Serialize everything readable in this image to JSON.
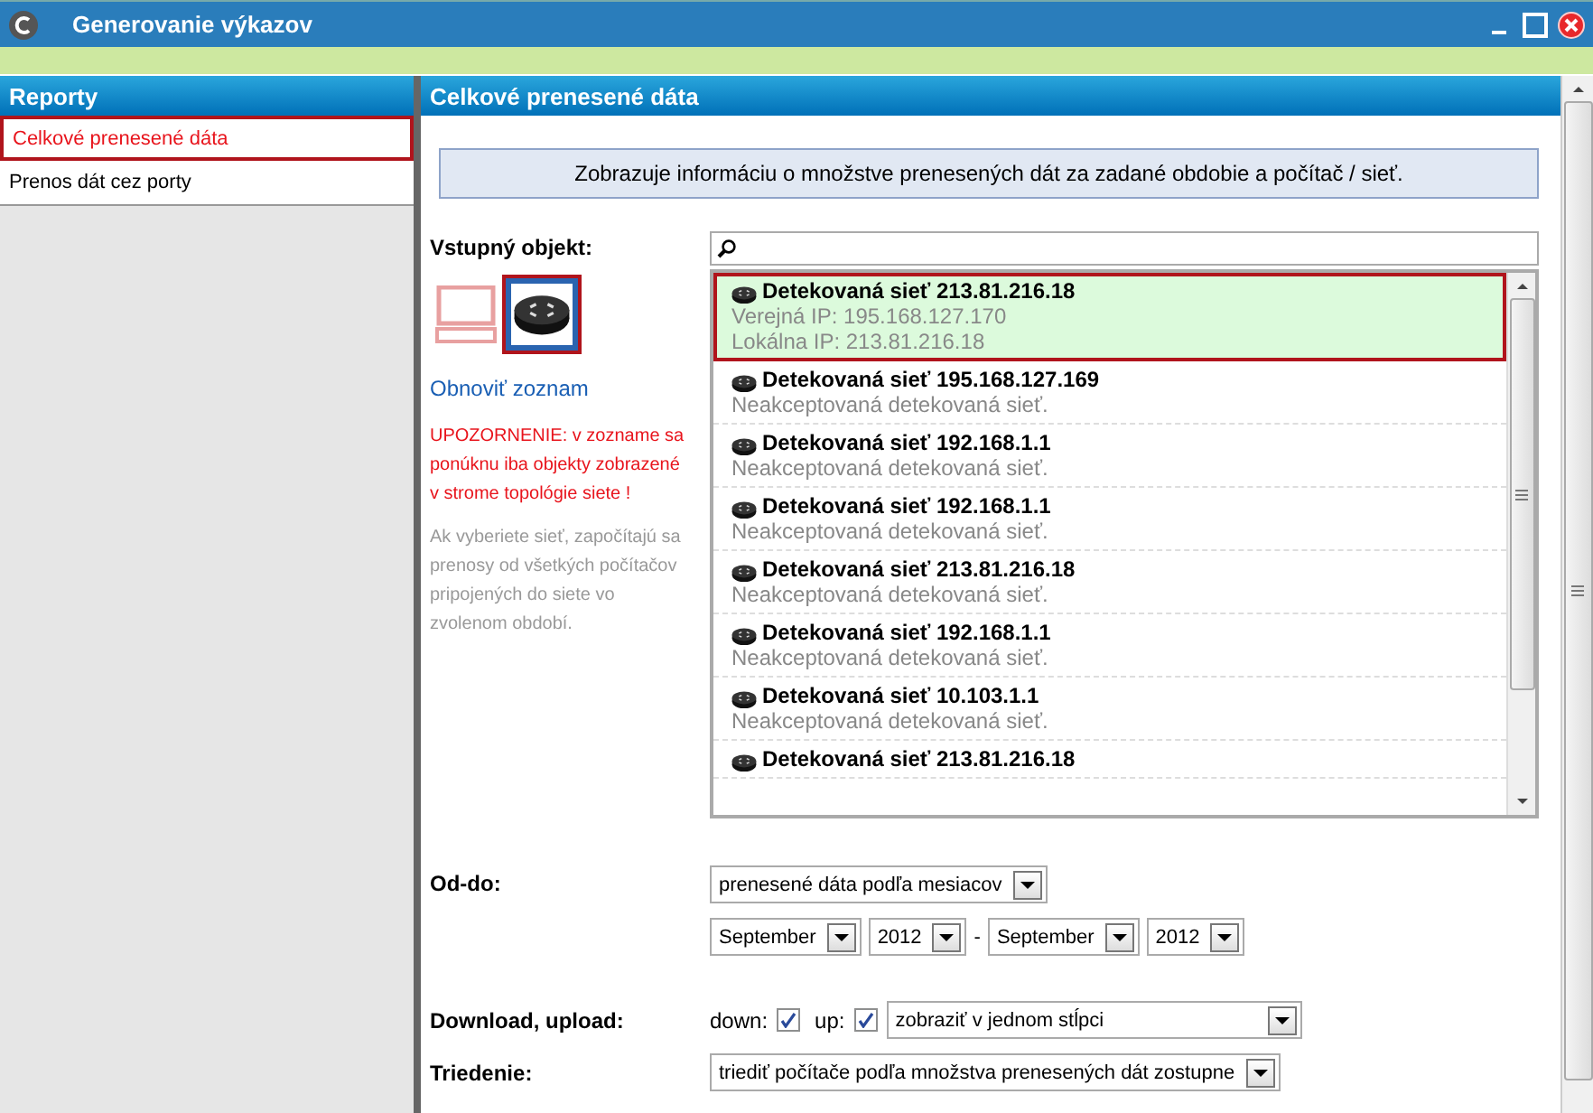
{
  "window": {
    "title": "Generovanie výkazov"
  },
  "sidebar": {
    "title": "Reporty",
    "items": [
      {
        "label": "Celkové prenesené dáta",
        "selected": true
      },
      {
        "label": "Prenos dát cez porty",
        "selected": false
      }
    ]
  },
  "main": {
    "title": "Celkové prenesené dáta",
    "description": "Zobrazuje informáciu o množstve prenesených dát za zadané obdobie a počítač / sieť.",
    "input_object": {
      "label": "Vstupný objekt:",
      "object_types": [
        {
          "kind": "computer",
          "selected": false
        },
        {
          "kind": "network",
          "selected": true
        }
      ],
      "refresh_link": "Obnoviť zoznam",
      "warning": "UPOZORNENIE: v zozname sa ponúknu iba objekty zobrazené v strome topológie siete !",
      "hint": "Ak vyberiete sieť, započítajú sa prenosy od všetkých počítačov pripojených do siete vo zvolenom období.",
      "items": [
        {
          "title": "Detekovaná sieť 213.81.216.18",
          "lines": [
            "Verejná IP: 195.168.127.170",
            "Lokálna IP: 213.81.216.18"
          ],
          "selected": true
        },
        {
          "title": "Detekovaná sieť 195.168.127.169",
          "lines": [
            "Neakceptovaná detekovaná sieť."
          ],
          "selected": false
        },
        {
          "title": "Detekovaná sieť 192.168.1.1",
          "lines": [
            "Neakceptovaná detekovaná sieť."
          ],
          "selected": false
        },
        {
          "title": "Detekovaná sieť 192.168.1.1",
          "lines": [
            "Neakceptovaná detekovaná sieť."
          ],
          "selected": false
        },
        {
          "title": "Detekovaná sieť 213.81.216.18",
          "lines": [
            "Neakceptovaná detekovaná sieť."
          ],
          "selected": false
        },
        {
          "title": "Detekovaná sieť 192.168.1.1",
          "lines": [
            "Neakceptovaná detekovaná sieť."
          ],
          "selected": false
        },
        {
          "title": "Detekovaná sieť 10.103.1.1",
          "lines": [
            "Neakceptovaná detekovaná sieť."
          ],
          "selected": false
        },
        {
          "title": "Detekovaná sieť 213.81.216.18",
          "selected": false
        }
      ]
    },
    "period": {
      "label": "Od-do:",
      "mode": "prenesené dáta podľa mesiacov",
      "from_month": "September",
      "from_year": "2012",
      "separator": "-",
      "to_month": "September",
      "to_year": "2012"
    },
    "traffic": {
      "label": "Download, upload:",
      "down_label": "down:",
      "down_checked": true,
      "up_label": "up:",
      "up_checked": true,
      "display": "zobraziť v jednom stĺpci"
    },
    "sorting": {
      "label": "Triedenie:",
      "value": "triediť počítače podľa množstva prenesených dát zostupne"
    }
  }
}
